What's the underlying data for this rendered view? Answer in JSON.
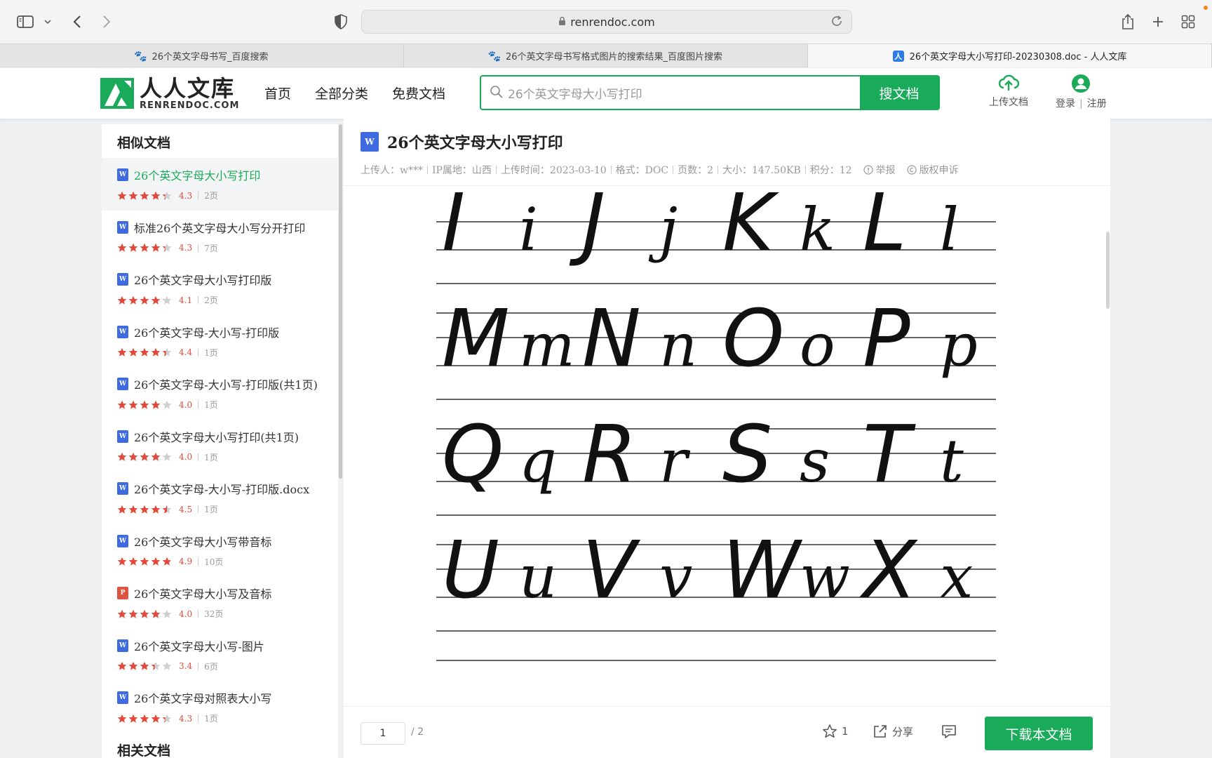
{
  "browser": {
    "url": "renrendoc.com",
    "tabs": [
      {
        "label": "26个英文字母书写_百度搜索",
        "favicon": "baidu-paw-icon",
        "active": false
      },
      {
        "label": "26个英文字母书写格式图片的搜索结果_百度图片搜索",
        "favicon": "baidu-paw-icon",
        "active": false
      },
      {
        "label": "26个英文字母大小写打印-20230308.doc - 人人文库",
        "favicon": "renrendoc-icon",
        "active": true
      }
    ]
  },
  "header": {
    "logo_cn": "人人文库",
    "logo_en": "RENRENDOC.COM",
    "nav": [
      "首页",
      "全部分类",
      "免费文档"
    ],
    "search_value": "26个英文字母大小写打印",
    "search_button": "搜文档",
    "upload_label": "上传文档",
    "login_label": "登录",
    "register_label": "注册",
    "brand_color": "#1aab5a"
  },
  "sidebar": {
    "title": "相似文档",
    "items": [
      {
        "title": "26个英文字母大小写打印",
        "type": "w",
        "rating": 4.3,
        "score": "4.3",
        "pages": "2页",
        "active": true
      },
      {
        "title": "标准26个英文字母大小写分开打印",
        "type": "w",
        "rating": 4.3,
        "score": "4.3",
        "pages": "7页",
        "active": false
      },
      {
        "title": "26个英文字母大小写打印版",
        "type": "w",
        "rating": 4.1,
        "score": "4.1",
        "pages": "2页",
        "active": false
      },
      {
        "title": "26个英文字母-大小写-打印版",
        "type": "w",
        "rating": 4.4,
        "score": "4.4",
        "pages": "1页",
        "active": false
      },
      {
        "title": "26个英文字母-大小写-打印版(共1页)",
        "type": "w",
        "rating": 4.0,
        "score": "4.0",
        "pages": "1页",
        "active": false
      },
      {
        "title": "26个英文字母大小写打印(共1页)",
        "type": "w",
        "rating": 4.0,
        "score": "4.0",
        "pages": "1页",
        "active": false
      },
      {
        "title": "26个英文字母-大小写-打印版.docx",
        "type": "w",
        "rating": 4.5,
        "score": "4.5",
        "pages": "1页",
        "active": false
      },
      {
        "title": "26个英文字母大小写带音标",
        "type": "w",
        "rating": 4.9,
        "score": "4.9",
        "pages": "10页",
        "active": false
      },
      {
        "title": "26个英文字母大小写及音标",
        "type": "p",
        "rating": 4.0,
        "score": "4.0",
        "pages": "32页",
        "active": false
      },
      {
        "title": "26个英文字母大小写-图片",
        "type": "w",
        "rating": 3.4,
        "score": "3.4",
        "pages": "6页",
        "active": false
      },
      {
        "title": "26个英文字母对照表大小写",
        "type": "w",
        "rating": 4.3,
        "score": "4.3",
        "pages": "1页",
        "active": false
      }
    ],
    "related_title": "相关文档"
  },
  "document": {
    "title": "26个英文字母大小写打印",
    "meta": [
      "上传人：w***",
      "IP属地：山西",
      "上传时间：2023-03-10",
      "格式：DOC",
      "页数：2",
      "大小：147.50KB",
      "积分：12"
    ],
    "report_label": "举报",
    "copyright_label": "版权申诉",
    "letters": [
      {
        "upper": "I",
        "lower": "i"
      },
      {
        "upper": "J",
        "lower": "j"
      },
      {
        "upper": "K",
        "lower": "k"
      },
      {
        "upper": "L",
        "lower": "l"
      },
      {
        "upper": "M",
        "lower": "m"
      },
      {
        "upper": "N",
        "lower": "n"
      },
      {
        "upper": "O",
        "lower": "o"
      },
      {
        "upper": "P",
        "lower": "p"
      },
      {
        "upper": "Q",
        "lower": "q"
      },
      {
        "upper": "R",
        "lower": "r"
      },
      {
        "upper": "S",
        "lower": "s"
      },
      {
        "upper": "T",
        "lower": "t"
      },
      {
        "upper": "U",
        "lower": "u"
      },
      {
        "upper": "V",
        "lower": "v"
      },
      {
        "upper": "W",
        "lower": "w"
      },
      {
        "upper": "X",
        "lower": "x"
      }
    ]
  },
  "bottom": {
    "page_current": "1",
    "page_total": "/ 2",
    "favorite_count": "1",
    "share_label": "分享",
    "download_label": "下载本文档"
  }
}
